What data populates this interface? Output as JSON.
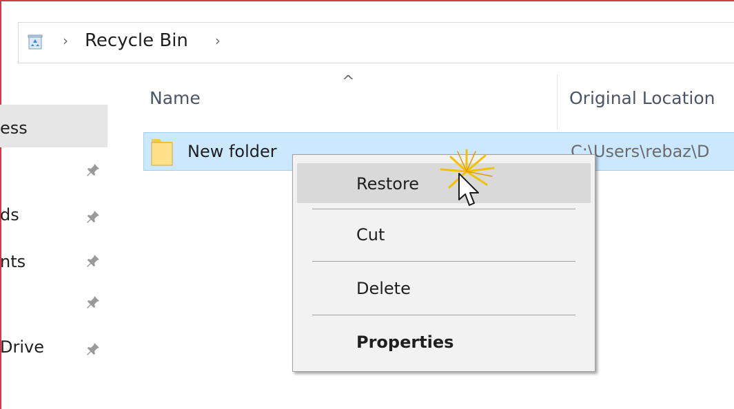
{
  "address_bar": {
    "separator": "›",
    "location": "Recycle Bin",
    "trailing_separator": "›"
  },
  "nav": {
    "items": [
      {
        "label": "ess",
        "pinned": false,
        "selected": true
      },
      {
        "label": "",
        "pinned": true
      },
      {
        "label": "ds",
        "pinned": true
      },
      {
        "label": "nts",
        "pinned": true
      },
      {
        "label": "",
        "pinned": true
      },
      {
        "label": "Drive",
        "pinned": true
      }
    ]
  },
  "columns": {
    "sort_indicator": "^",
    "name": "Name",
    "original_location": "Original Location"
  },
  "rows": [
    {
      "name": "New folder",
      "original_location": "C:\\Users\\rebaz\\D"
    }
  ],
  "context_menu": {
    "items": [
      "Restore",
      "Cut",
      "Delete",
      "Properties"
    ]
  },
  "colors": {
    "selection_bg": "#cce8ff",
    "selection_border": "#99d1ff",
    "menu_bg": "#f2f2f2",
    "menu_highlight": "#d9d9d9",
    "frame_accent": "#d23a4a"
  }
}
